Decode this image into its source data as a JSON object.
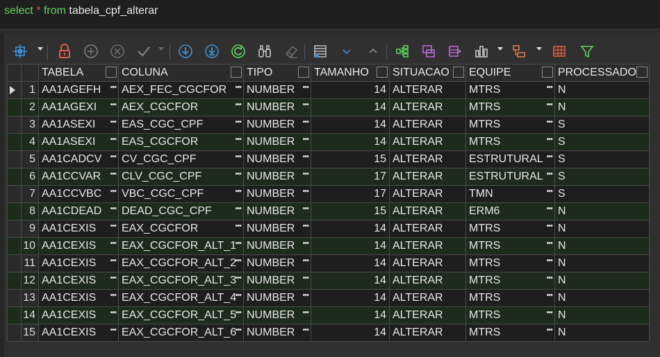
{
  "editor": {
    "kw_select": "select",
    "star": "*",
    "kw_from": "from",
    "table_name": "tabela_cpf_alterar"
  },
  "toolbar": {
    "icons": [
      "grid-settings-icon",
      "lock-icon",
      "add-row-icon",
      "delete-row-icon",
      "commit-check-icon",
      "fetch-next-icon",
      "fetch-all-icon",
      "refresh-icon",
      "find-icon",
      "clear-icon",
      "single-record-icon",
      "sort-desc-icon",
      "sort-asc-icon",
      "tree-view-icon",
      "pivot-icon",
      "export-icon",
      "chart-icon",
      "group-icon",
      "table-view-icon",
      "filter-icon"
    ]
  },
  "grid": {
    "columns": [
      "TABELA",
      "COLUNA",
      "TIPO",
      "TAMANHO",
      "SITUACAO",
      "EQUIPE",
      "PROCESSADO"
    ],
    "rows": [
      {
        "n": "1",
        "tabela": "AA1AGEFH",
        "coluna": "AEX_FEC_CGCFOR",
        "tipo": "NUMBER",
        "tamanho": "14",
        "situacao": "ALTERAR",
        "equipe": "MTRS",
        "processado": "N"
      },
      {
        "n": "2",
        "tabela": "AA1AGEXI",
        "coluna": "AEX_CGCFOR",
        "tipo": "NUMBER",
        "tamanho": "14",
        "situacao": "ALTERAR",
        "equipe": "MTRS",
        "processado": "N"
      },
      {
        "n": "3",
        "tabela": "AA1ASEXI",
        "coluna": "EAS_CGC_CPF",
        "tipo": "NUMBER",
        "tamanho": "14",
        "situacao": "ALTERAR",
        "equipe": "MTRS",
        "processado": "S"
      },
      {
        "n": "4",
        "tabela": "AA1ASEXI",
        "coluna": "EAS_CGCFOR",
        "tipo": "NUMBER",
        "tamanho": "14",
        "situacao": "ALTERAR",
        "equipe": "MTRS",
        "processado": "S"
      },
      {
        "n": "5",
        "tabela": "AA1CADCV",
        "coluna": "CV_CGC_CPF",
        "tipo": "NUMBER",
        "tamanho": "15",
        "situacao": "ALTERAR",
        "equipe": "ESTRUTURAL",
        "processado": "S"
      },
      {
        "n": "6",
        "tabela": "AA1CCVAR",
        "coluna": "CLV_CGC_CPF",
        "tipo": "NUMBER",
        "tamanho": "17",
        "situacao": "ALTERAR",
        "equipe": "ESTRUTURAL",
        "processado": "S"
      },
      {
        "n": "7",
        "tabela": "AA1CCVBC",
        "coluna": "VBC_CGC_CPF",
        "tipo": "NUMBER",
        "tamanho": "17",
        "situacao": "ALTERAR",
        "equipe": "TMN",
        "processado": "S"
      },
      {
        "n": "8",
        "tabela": "AA1CDEAD",
        "coluna": "DEAD_CGC_CPF",
        "tipo": "NUMBER",
        "tamanho": "15",
        "situacao": "ALTERAR",
        "equipe": "ERM6",
        "processado": "N"
      },
      {
        "n": "9",
        "tabela": "AA1CEXIS",
        "coluna": "EAX_CGCFOR",
        "tipo": "NUMBER",
        "tamanho": "14",
        "situacao": "ALTERAR",
        "equipe": "MTRS",
        "processado": "N"
      },
      {
        "n": "10",
        "tabela": "AA1CEXIS",
        "coluna": "EAX_CGCFOR_ALT_1",
        "tipo": "NUMBER",
        "tamanho": "14",
        "situacao": "ALTERAR",
        "equipe": "MTRS",
        "processado": "N"
      },
      {
        "n": "11",
        "tabela": "AA1CEXIS",
        "coluna": "EAX_CGCFOR_ALT_2",
        "tipo": "NUMBER",
        "tamanho": "14",
        "situacao": "ALTERAR",
        "equipe": "MTRS",
        "processado": "N"
      },
      {
        "n": "12",
        "tabela": "AA1CEXIS",
        "coluna": "EAX_CGCFOR_ALT_3",
        "tipo": "NUMBER",
        "tamanho": "14",
        "situacao": "ALTERAR",
        "equipe": "MTRS",
        "processado": "N"
      },
      {
        "n": "13",
        "tabela": "AA1CEXIS",
        "coluna": "EAX_CGCFOR_ALT_4",
        "tipo": "NUMBER",
        "tamanho": "14",
        "situacao": "ALTERAR",
        "equipe": "MTRS",
        "processado": "N"
      },
      {
        "n": "14",
        "tabela": "AA1CEXIS",
        "coluna": "EAX_CGCFOR_ALT_5",
        "tipo": "NUMBER",
        "tamanho": "14",
        "situacao": "ALTERAR",
        "equipe": "MTRS",
        "processado": "N"
      },
      {
        "n": "15",
        "tabela": "AA1CEXIS",
        "coluna": "EAX_CGCFOR_ALT_6",
        "tipo": "NUMBER",
        "tamanho": "14",
        "situacao": "ALTERAR",
        "equipe": "MTRS",
        "processado": "N"
      }
    ],
    "selected_row": "1",
    "colors": {
      "row_even": "#1e1e1e",
      "row_alt": "#1d2b1c",
      "accent": "#3d8fd6",
      "sql_keyword": "#5fd35f",
      "sql_star": "#d94f4f"
    }
  }
}
